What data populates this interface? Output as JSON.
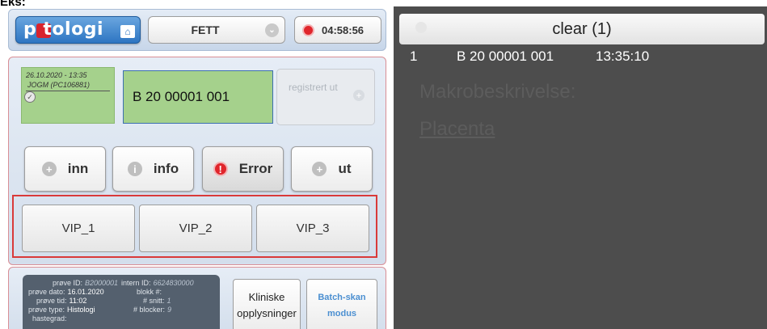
{
  "top_label": "Eks:",
  "header": {
    "logo_text": "p  tologi",
    "fett_select": "FETT",
    "timer": "04:58:56"
  },
  "user_box": {
    "date": "26.10.2020 - 13:35",
    "user": "JOGM (PC106881)"
  },
  "sample": {
    "id": "B 20 00001 001"
  },
  "registered": {
    "label": "registrert ut"
  },
  "actions": {
    "inn": "inn",
    "info": "info",
    "error": "Error",
    "ut": "ut"
  },
  "vip": [
    "VIP_1",
    "VIP_2",
    "VIP_3"
  ],
  "info_panel": {
    "prove_id_k": "prøve ID:",
    "prove_id_v": "B2000001",
    "intern_id_k": "intern ID:",
    "intern_id_v": "6624830000",
    "prove_dato_k": "prøve dato:",
    "prove_dato_v": "16.01.2020",
    "blokk_k": "blokk #:",
    "blokk_v": "",
    "prove_tid_k": "prøve tid:",
    "prove_tid_v": "11:02",
    "snitt_k": "# snitt:",
    "snitt_v": "1",
    "prove_type_k": "prøve type:",
    "prove_type_v": "Histologi",
    "blocker_k": "# blocker:",
    "blocker_v": "9",
    "hastegrad_k": "hastegrad:"
  },
  "buttons": {
    "kliniske_line1": "Kliniske",
    "kliniske_line2": "opplysninger",
    "batch_line1": "Batch-skan",
    "batch_line2": "modus"
  },
  "right_panel": {
    "clear_label": "clear (1)",
    "log": [
      {
        "num": "1",
        "id": "B 20 00001 001",
        "time": "13:35:10"
      }
    ],
    "ghost_line1": "Makrobeskrivelse:",
    "ghost_line2": "Placenta"
  },
  "colors": {
    "green_box": "#a5d18c",
    "red_frame": "#d93a3a",
    "dark_panel": "#4d4d4d",
    "logo_blue": "#2d75c2",
    "batch_blue": "#4b8fd1"
  }
}
